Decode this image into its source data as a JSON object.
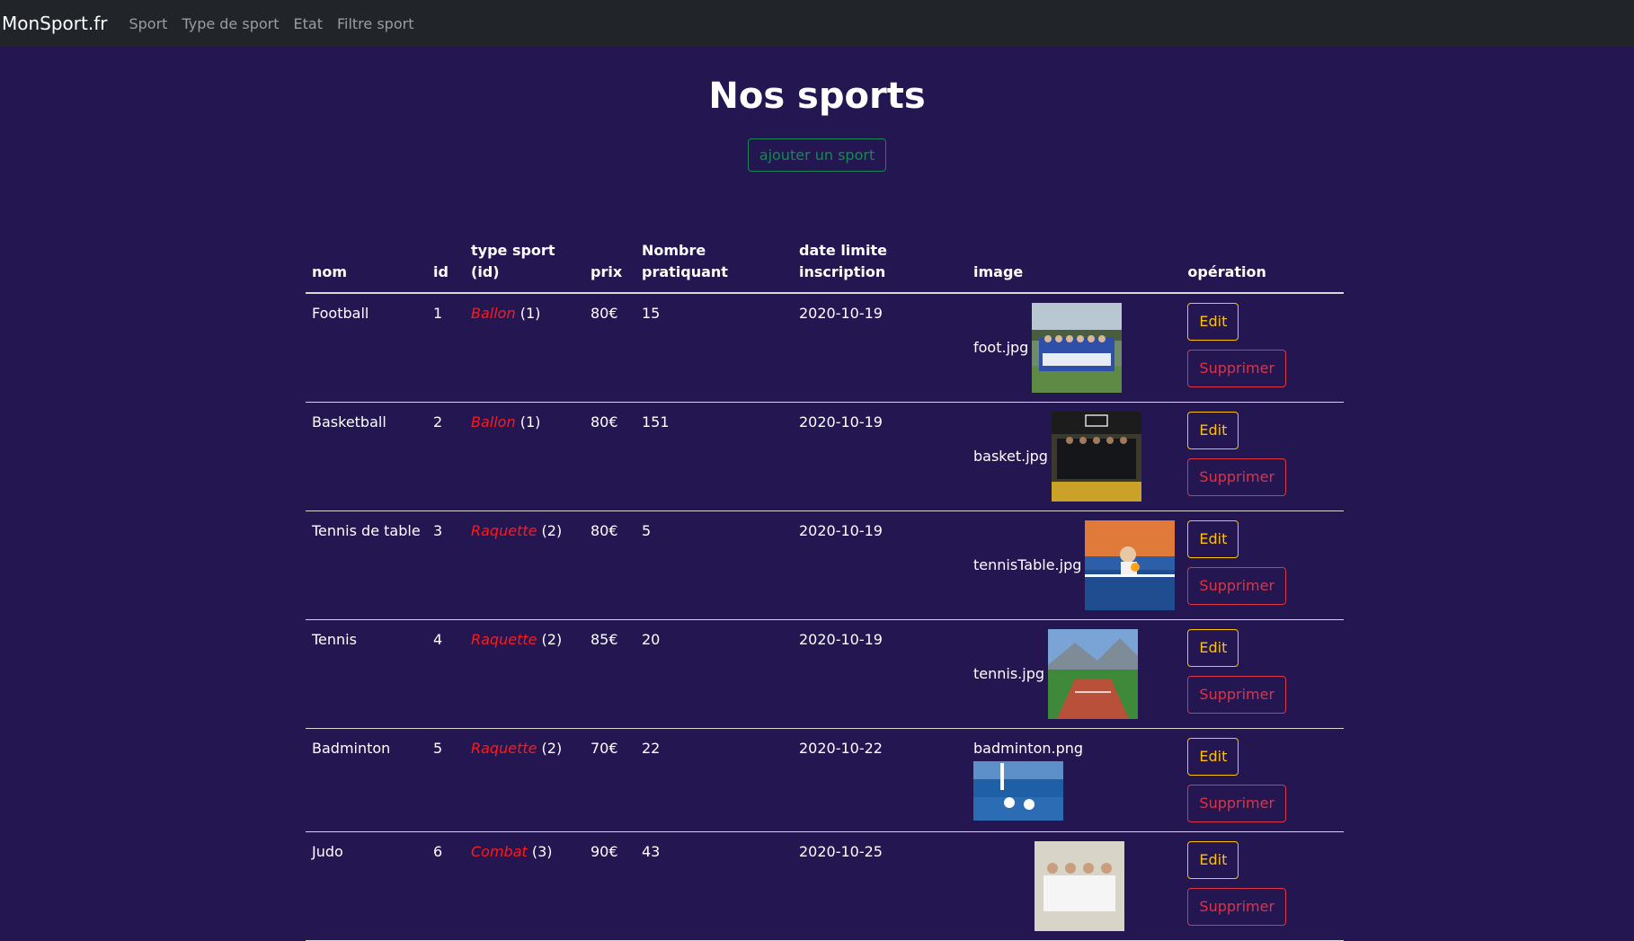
{
  "navbar": {
    "brand": "MonSport.fr",
    "links": [
      "Sport",
      "Type de sport",
      "Etat",
      "Filtre sport"
    ]
  },
  "page": {
    "title": "Nos sports",
    "add_button": "ajouter un sport"
  },
  "table": {
    "headers": {
      "nom": "nom",
      "id": "id",
      "type": "type sport (id)",
      "prix": "prix",
      "nombre": "Nombre pratiquant",
      "date": "date limite inscription",
      "image": "image",
      "operation": "opération"
    },
    "rows": [
      {
        "nom": "Football",
        "id": "1",
        "type_name": "Ballon",
        "type_id": "(1)",
        "prix": "80€",
        "nombre": "15",
        "date": "2020-10-19",
        "image": "foot.jpg",
        "edit": "Edit",
        "delete": "Supprimer"
      },
      {
        "nom": "Basketball",
        "id": "2",
        "type_name": "Ballon",
        "type_id": "(1)",
        "prix": "80€",
        "nombre": "151",
        "date": "2020-10-19",
        "image": "basket.jpg",
        "edit": "Edit",
        "delete": "Supprimer"
      },
      {
        "nom": "Tennis de table",
        "id": "3",
        "type_name": "Raquette",
        "type_id": "(2)",
        "prix": "80€",
        "nombre": "5",
        "date": "2020-10-19",
        "image": "tennisTable.jpg",
        "edit": "Edit",
        "delete": "Supprimer"
      },
      {
        "nom": "Tennis",
        "id": "4",
        "type_name": "Raquette",
        "type_id": "(2)",
        "prix": "85€",
        "nombre": "20",
        "date": "2020-10-19",
        "image": "tennis.jpg",
        "edit": "Edit",
        "delete": "Supprimer"
      },
      {
        "nom": "Badminton",
        "id": "5",
        "type_name": "Raquette",
        "type_id": "(2)",
        "prix": "70€",
        "nombre": "22",
        "date": "2020-10-22",
        "image": "badminton.png",
        "edit": "Edit",
        "delete": "Supprimer"
      },
      {
        "nom": "Judo",
        "id": "6",
        "type_name": "Combat",
        "type_id": "(3)",
        "prix": "90€",
        "nombre": "43",
        "date": "2020-10-25",
        "image": "",
        "edit": "Edit",
        "delete": "Supprimer"
      }
    ]
  }
}
